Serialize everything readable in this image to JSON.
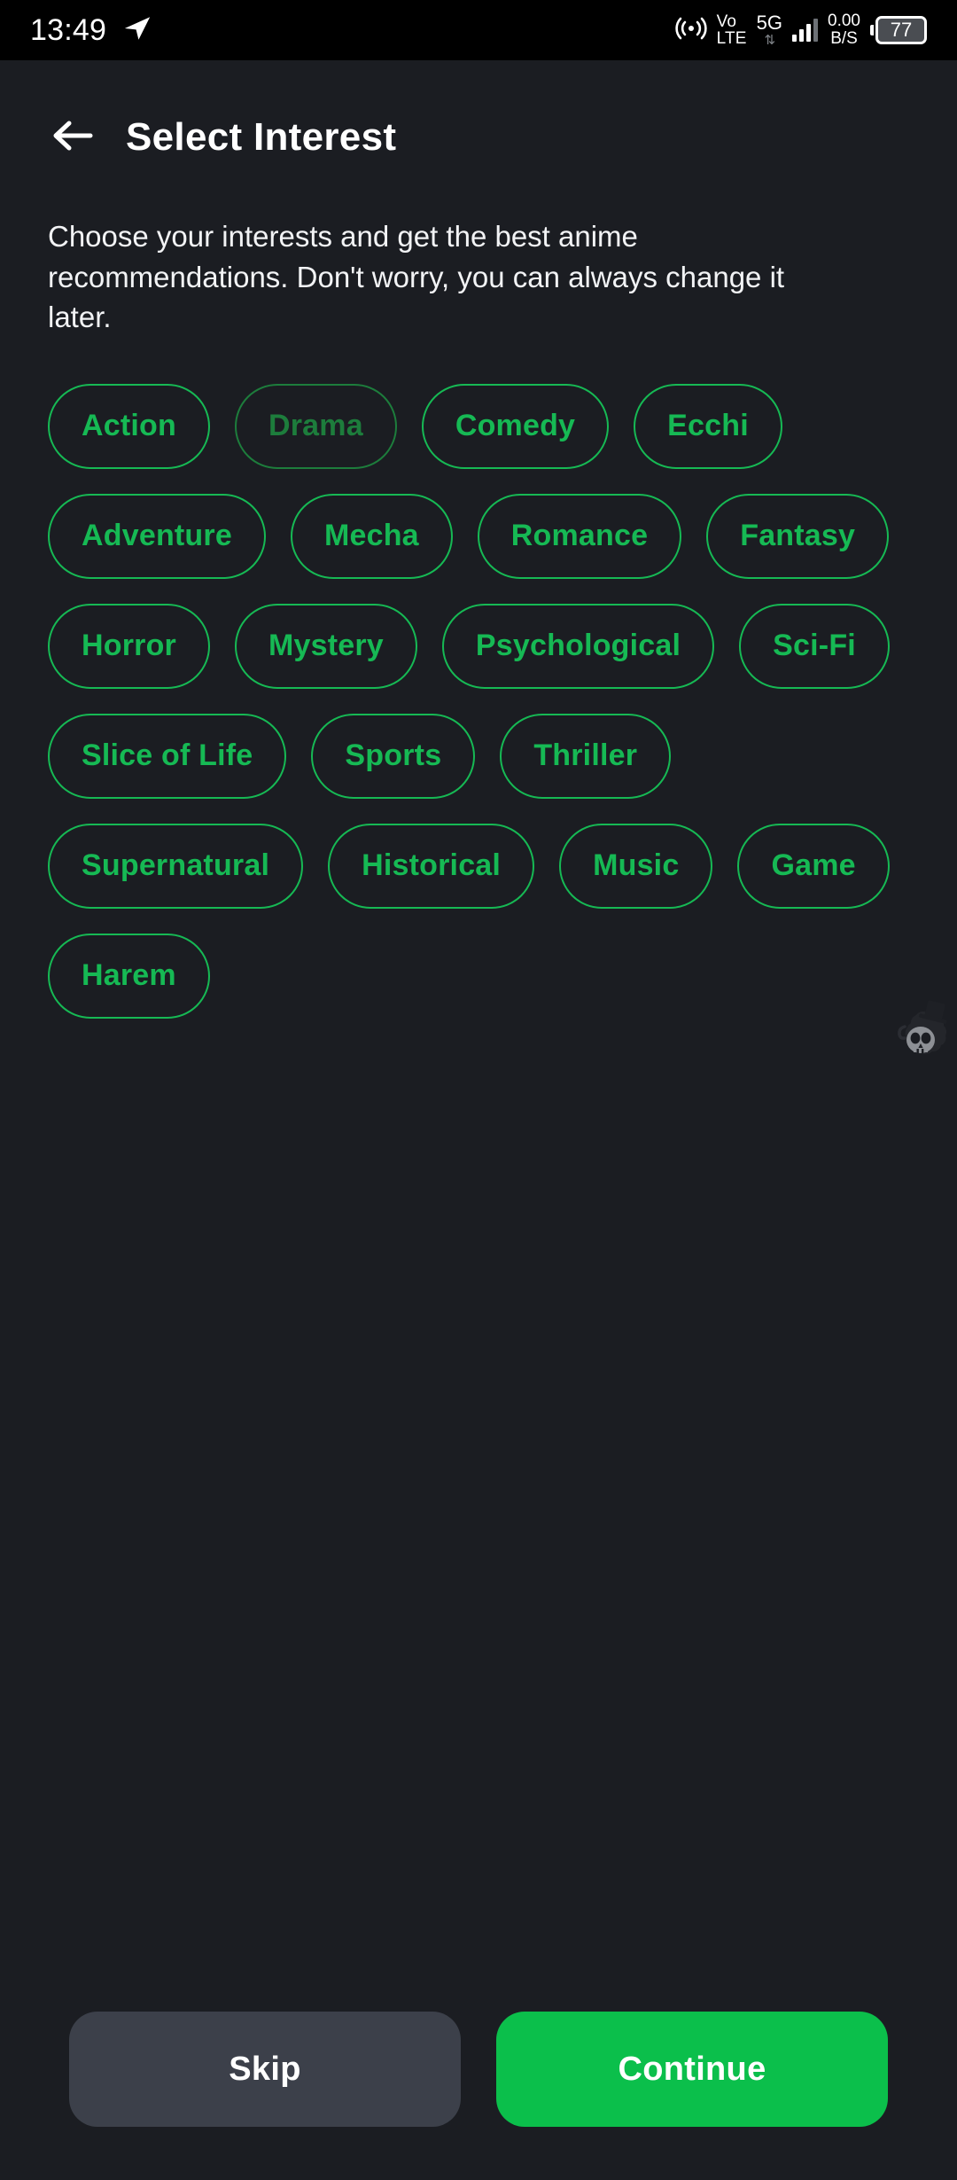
{
  "status_bar": {
    "time": "13:49",
    "send_icon": "telegram-send-icon",
    "hotspot_icon": "rss-signal-icon",
    "volte_top": "Vo",
    "volte_bottom": "LTE",
    "network": "5G",
    "data_arrows": "⇅",
    "data_rate_value": "0.00",
    "data_rate_unit": "B/S",
    "battery_percent": "77"
  },
  "header": {
    "back_icon": "back-arrow-icon",
    "title": "Select Interest"
  },
  "description": "Choose your interests and get the best anime recommendations. Don't worry, you can always change it later.",
  "interests": [
    {
      "label": "Action",
      "state": "normal"
    },
    {
      "label": "Drama",
      "state": "dim"
    },
    {
      "label": "Comedy",
      "state": "normal"
    },
    {
      "label": "Ecchi",
      "state": "normal"
    },
    {
      "label": "Adventure",
      "state": "normal"
    },
    {
      "label": "Mecha",
      "state": "normal"
    },
    {
      "label": "Romance",
      "state": "normal"
    },
    {
      "label": "Fantasy",
      "state": "normal"
    },
    {
      "label": "Horror",
      "state": "normal"
    },
    {
      "label": "Mystery",
      "state": "normal"
    },
    {
      "label": "Psychological",
      "state": "normal"
    },
    {
      "label": "Sci-Fi",
      "state": "normal"
    },
    {
      "label": "Slice of Life",
      "state": "normal"
    },
    {
      "label": "Sports",
      "state": "normal"
    },
    {
      "label": "Thriller",
      "state": "normal"
    },
    {
      "label": "Supernatural",
      "state": "normal"
    },
    {
      "label": "Historical",
      "state": "normal"
    },
    {
      "label": "Music",
      "state": "normal"
    },
    {
      "label": "Game",
      "state": "normal"
    },
    {
      "label": "Harem",
      "state": "normal"
    }
  ],
  "overlay": {
    "icon": "skull-top-hat-icon"
  },
  "actions": {
    "skip_label": "Skip",
    "continue_label": "Continue"
  },
  "colors": {
    "background": "#1b1d22",
    "accent_green": "#16b954",
    "accent_green_dim": "#1d7d3c",
    "continue_green": "#0bbf4b",
    "skip_gray": "#3c404a",
    "text_white": "#ffffff"
  }
}
